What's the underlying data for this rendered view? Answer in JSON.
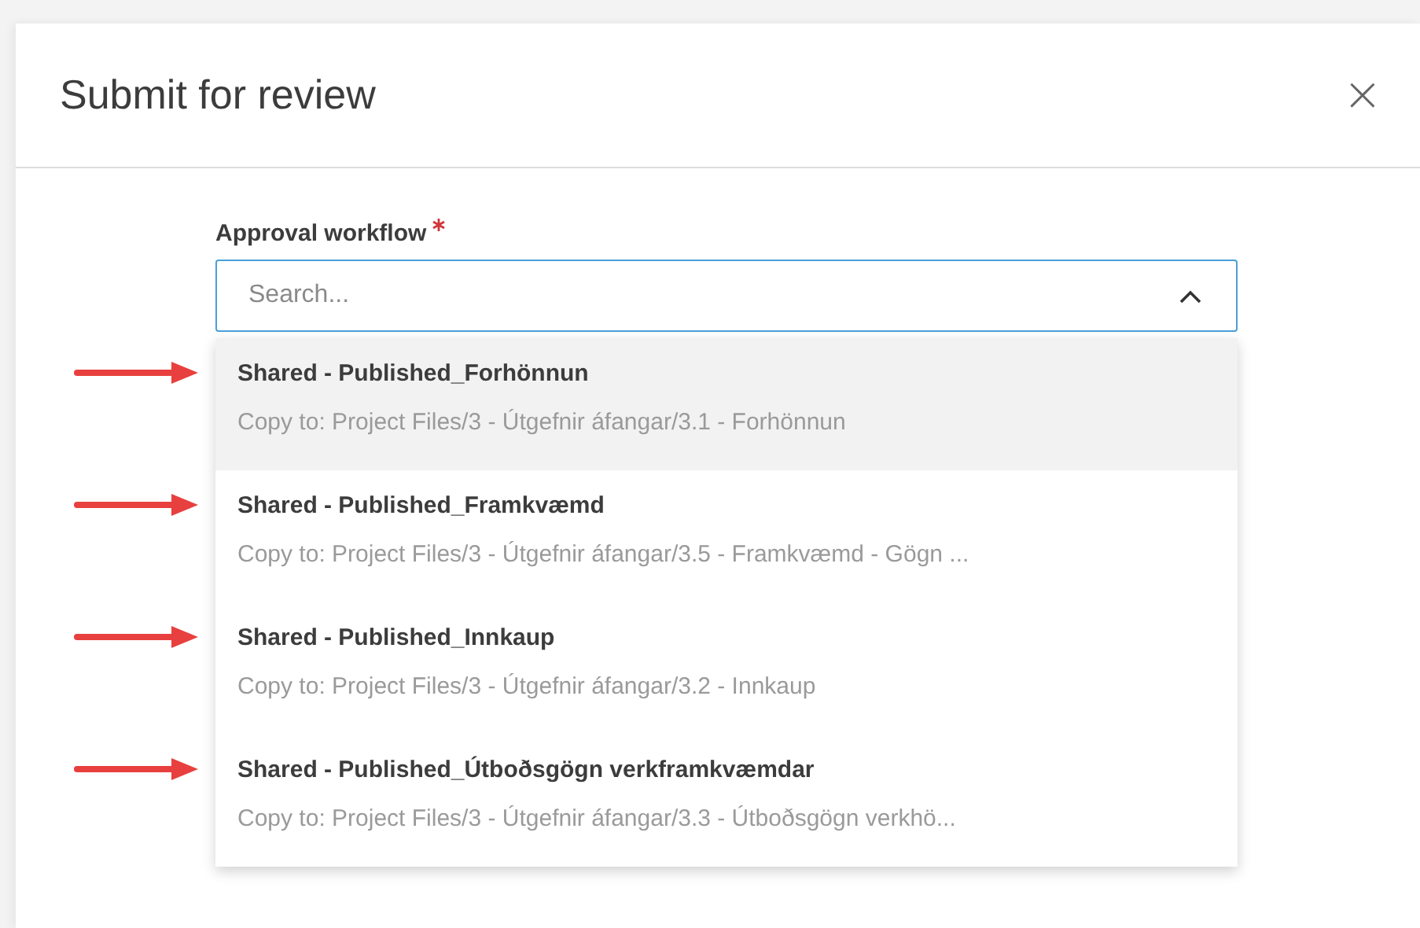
{
  "dialog": {
    "title": "Submit for review",
    "close": "×"
  },
  "field": {
    "label": "Approval workflow",
    "required": true,
    "placeholder": "Search...",
    "expanded": true
  },
  "options": [
    {
      "title": "Shared - Published_Forhönnun",
      "path": "Copy to: Project Files/3 - Útgefnir áfangar/3.1 - Forhönnun",
      "selected": true,
      "arrow": true
    },
    {
      "title": "Shared - Published_Framkvæmd",
      "path": "Copy to: Project Files/3 - Útgefnir áfangar/3.5 - Framkvæmd - Gögn ...",
      "selected": false,
      "arrow": true
    },
    {
      "title": "Shared - Published_Innkaup",
      "path": "Copy to: Project Files/3 - Útgefnir áfangar/3.2 - Innkaup",
      "selected": false,
      "arrow": true
    },
    {
      "title": "Shared - Published_Útboðsgögn verkframkvæmdar",
      "path": "Copy to: Project Files/3 - Útgefnir áfangar/3.3 - Útboðsgögn verkhö...",
      "selected": false,
      "arrow": true
    }
  ]
}
